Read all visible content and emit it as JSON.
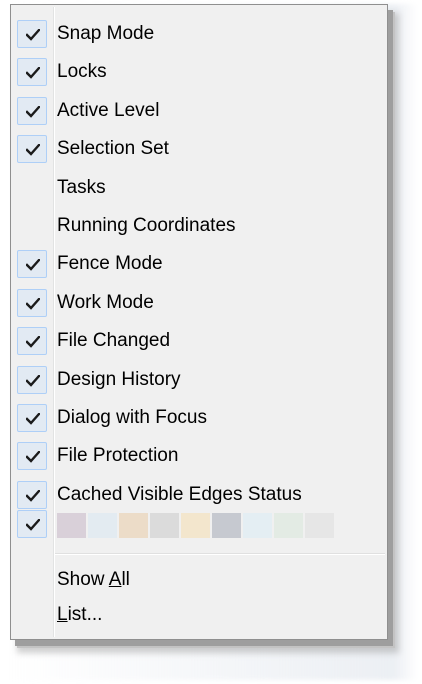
{
  "menu": {
    "items": [
      {
        "label": "Snap Mode",
        "checked": true
      },
      {
        "label": "Locks",
        "checked": true
      },
      {
        "label": "Active Level",
        "checked": true
      },
      {
        "label": "Selection Set",
        "checked": true
      },
      {
        "label": "Tasks",
        "checked": false
      },
      {
        "label": "Running Coordinates",
        "checked": false
      },
      {
        "label": "Fence Mode",
        "checked": true
      },
      {
        "label": "Work Mode",
        "checked": true
      },
      {
        "label": "File Changed",
        "checked": true
      },
      {
        "label": "Design History",
        "checked": true
      },
      {
        "label": "Dialog with Focus",
        "checked": true
      },
      {
        "label": "File Protection",
        "checked": true
      },
      {
        "label": "Cached Visible Edges Status",
        "checked": true
      }
    ],
    "swatch_item": {
      "checked": true,
      "colors": [
        "#d9d0d9",
        "#e3ebf1",
        "#ecdcc8",
        "#dbdbdb",
        "#f3e6cd",
        "#c6c9d0",
        "#e4eef3",
        "#e3ebe4",
        "#e6e6e6"
      ]
    },
    "show_all": {
      "prefix": "Show ",
      "mnemonic": "A",
      "suffix": "ll"
    },
    "list": {
      "mnemonic": "L",
      "suffix": "ist..."
    }
  },
  "colors": {
    "menu_background": "#f0f0f0",
    "check_background": "#e2eaf3",
    "check_border": "#aecff7",
    "text": "#000000"
  }
}
